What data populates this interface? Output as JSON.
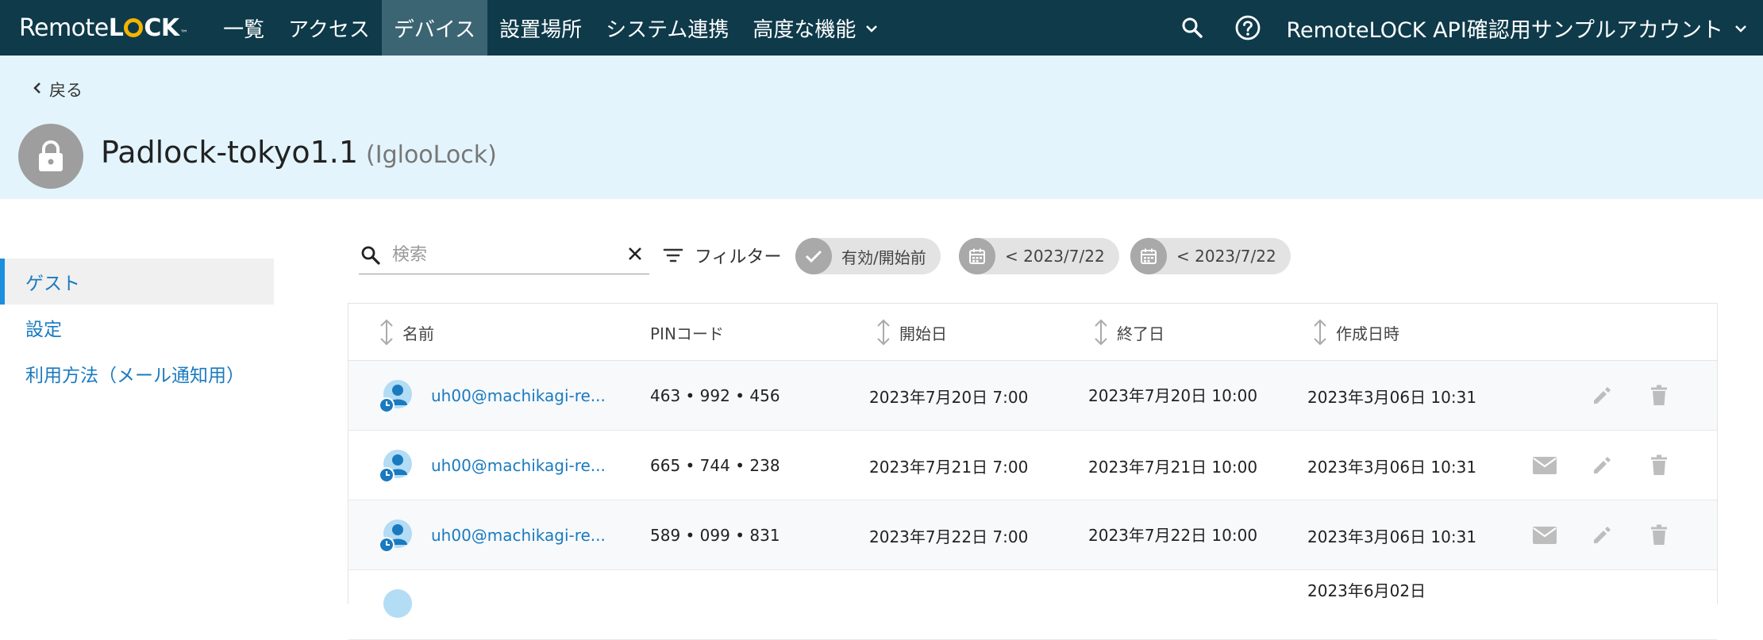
{
  "nav": {
    "logo_text_pre": "Remote",
    "logo_text_l": "L",
    "logo_text_post": "CK",
    "logo_tm": "™",
    "items": [
      {
        "label": "一覧"
      },
      {
        "label": "アクセス"
      },
      {
        "label": "デバイス",
        "active": true
      },
      {
        "label": "設置場所"
      },
      {
        "label": "システム連携"
      },
      {
        "label": "高度な機能"
      }
    ],
    "account": "RemoteLOCK API確認用サンプルアカウント"
  },
  "header": {
    "back_label": "戻る",
    "device_name": "Padlock-tokyo1.1",
    "device_type": "(IglooLock)"
  },
  "sidebar": {
    "items": [
      {
        "label": "ゲスト",
        "active": true
      },
      {
        "label": "設定"
      },
      {
        "label": "利用方法（メール通知用）"
      }
    ]
  },
  "toolbar": {
    "search_placeholder": "検索",
    "search_value": "",
    "filter_label": "フィルター",
    "chips": [
      {
        "label": "有効/開始前"
      },
      {
        "label": "< 2023/7/22"
      },
      {
        "label": "< 2023/7/22"
      }
    ]
  },
  "table": {
    "columns": [
      "名前",
      "PINコード",
      "開始日",
      "終了日",
      "作成日時"
    ],
    "rows": [
      {
        "name": "uh00@machikagi-re...",
        "pin": "463 • 992 • 456",
        "start": "2023年7月20日 7:00",
        "end": "2023年7月20日 10:00",
        "created": "2023年3月06日 10:31",
        "has_mail": false
      },
      {
        "name": "uh00@machikagi-re...",
        "pin": "665 • 744 • 238",
        "start": "2023年7月21日 7:00",
        "end": "2023年7月21日 10:00",
        "created": "2023年3月06日 10:31",
        "has_mail": true
      },
      {
        "name": "uh00@machikagi-re...",
        "pin": "589 • 099 • 831",
        "start": "2023年7月22日 7:00",
        "end": "2023年7月22日 10:00",
        "created": "2023年3月06日 10:31",
        "has_mail": true
      },
      {
        "name": "",
        "pin": "",
        "start": "",
        "end": "",
        "created": "2023年6月02日",
        "has_mail": false
      }
    ]
  },
  "colors": {
    "nav_bg": "#0e3a4a",
    "nav_active": "#3c6574",
    "header_band": "#e3f4fc",
    "link": "#1a7abf",
    "logo_accent": "#f4b400"
  }
}
